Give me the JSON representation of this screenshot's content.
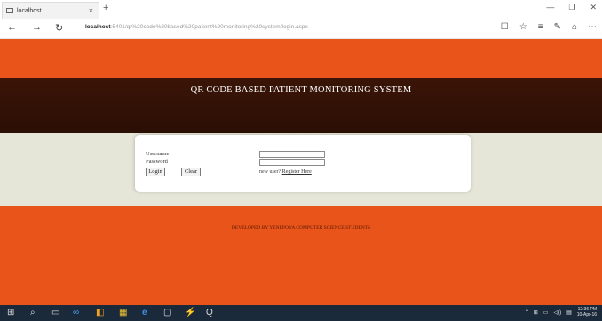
{
  "browser": {
    "tab_title": "localhost",
    "tab_close": "×",
    "new_tab": "+",
    "window_controls": [
      "—",
      "❐",
      "✕"
    ],
    "nav": {
      "back": "←",
      "forward": "→",
      "refresh": "↻"
    },
    "address": {
      "host": "localhost",
      "path": ":5401/qr%20code%20based%20patient%20monitoring%20system/login.aspx"
    },
    "right_icons": [
      "☐",
      "☆",
      "≡",
      "✎",
      "⌂",
      "⋯"
    ]
  },
  "page": {
    "title": "QR CODE  BASED  PATIENT  MONITORING  SYSTEM",
    "login": {
      "username_label": "Username",
      "password_label": "Password",
      "login_button": "Login",
      "clear_button": "Clear",
      "new_user_text": "new user?",
      "register_link": "Register Here"
    },
    "footer": "DEVELOPED BY YENEPOYA COMPUTER SCIENCE STUDENTS"
  },
  "taskbar": {
    "icons": [
      "⊞",
      "⌕",
      "▭",
      "∞",
      "◧",
      "▦",
      "e",
      "▢",
      "⚡",
      "Q"
    ],
    "tray_icons": [
      "^",
      "⊞",
      "▭",
      "◁))",
      "▤"
    ],
    "time": "12:36 PM",
    "date": "10-Apr-16"
  }
}
